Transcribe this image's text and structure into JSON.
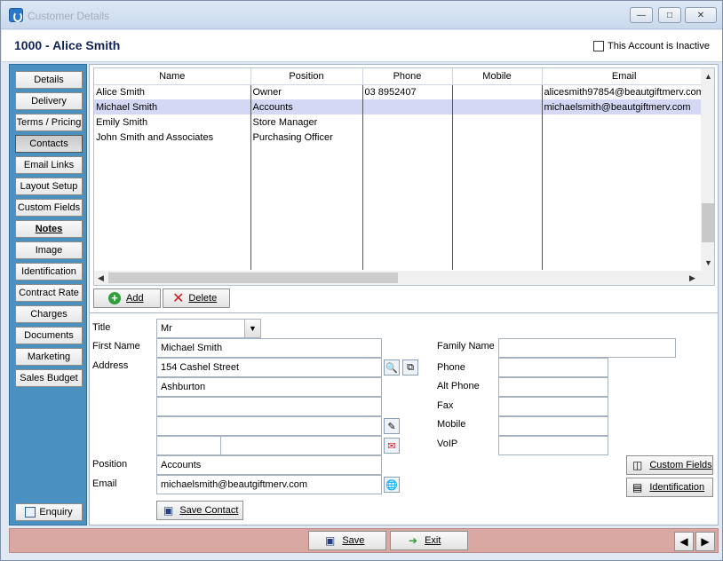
{
  "window": {
    "title": "Customer Details",
    "minimize": "—",
    "maximize": "□",
    "close": "✕"
  },
  "header": {
    "account_title": "1000 - Alice Smith",
    "inactive_label": "This Account is Inactive"
  },
  "sidebar": {
    "items": [
      {
        "label": "Details"
      },
      {
        "label": "Delivery"
      },
      {
        "label": "Terms / Pricing"
      },
      {
        "label": "Contacts"
      },
      {
        "label": "Email Links"
      },
      {
        "label": "Layout Setup"
      },
      {
        "label": "Custom Fields"
      },
      {
        "label": "Notes"
      },
      {
        "label": "Image"
      },
      {
        "label": "Identification"
      },
      {
        "label": "Contract Rate"
      },
      {
        "label": "Charges"
      },
      {
        "label": "Documents"
      },
      {
        "label": "Marketing"
      },
      {
        "label": "Sales Budget"
      }
    ],
    "enquiry_label": "Enquiry"
  },
  "contacts": {
    "columns": [
      "Name",
      "Position",
      "Phone",
      "Mobile",
      "Email"
    ],
    "rows": [
      {
        "name": "Alice Smith",
        "position": "Owner",
        "phone": "03 8952407",
        "mobile": "",
        "email": "alicesmith97854@beautgiftmerv.com"
      },
      {
        "name": "Michael Smith",
        "position": "Accounts",
        "phone": "",
        "mobile": "",
        "email": "michaelsmith@beautgiftmerv.com"
      },
      {
        "name": "Emily Smith",
        "position": "Store Manager",
        "phone": "",
        "mobile": "",
        "email": ""
      },
      {
        "name": "John Smith and Associates",
        "position": "Purchasing Officer",
        "phone": "",
        "mobile": "",
        "email": ""
      }
    ],
    "selected_row": 1,
    "add_label": "Add",
    "delete_label": "Delete"
  },
  "form": {
    "title_label": "Title",
    "title_value": "Mr",
    "first_name_label": "First Name",
    "first_name_value": "Michael Smith",
    "address_label": "Address",
    "address_line1": "154 Cashel Street",
    "address_line2": "Ashburton",
    "address_line3": "",
    "address_line4": "",
    "address_postcode": "",
    "address_country": "",
    "position_label": "Position",
    "position_value": "Accounts",
    "email_label": "Email",
    "email_value": "michaelsmith@beautgiftmerv.com",
    "family_name_label": "Family Name",
    "family_name_value": "",
    "phone_label": "Phone",
    "phone_value": "",
    "alt_phone_label": "Alt Phone",
    "alt_phone_value": "",
    "fax_label": "Fax",
    "fax_value": "",
    "mobile_label": "Mobile",
    "mobile_value": "",
    "voip_label": "VoIP",
    "voip_value": "",
    "custom_fields_label": "Custom Fields",
    "identification_label": "Identification",
    "save_contact_label": "Save Contact"
  },
  "footer": {
    "save_label": "Save",
    "exit_label": "Exit",
    "prev": "◀",
    "next": "▶"
  }
}
